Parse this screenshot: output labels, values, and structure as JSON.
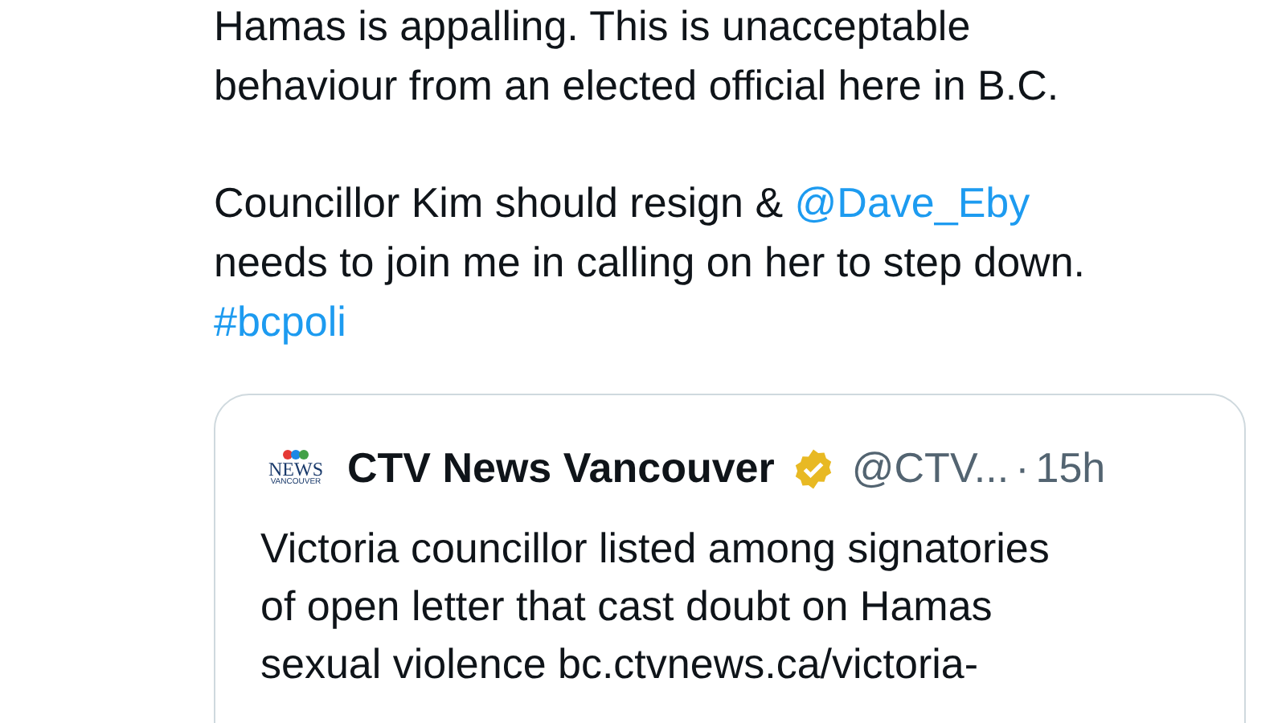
{
  "tweet": {
    "paragraphs": [
      [
        [
          {
            "kind": "text",
            "text": "Hamas is appalling. This is unacceptable"
          }
        ],
        [
          {
            "kind": "text",
            "text": "behaviour from an elected official here in B.C."
          }
        ]
      ],
      [
        [
          {
            "kind": "text",
            "text": "Councillor Kim should resign & "
          },
          {
            "kind": "link",
            "text": "@Dave_Eby"
          }
        ],
        [
          {
            "kind": "text",
            "text": "needs to join me in calling on her to step down."
          }
        ],
        [
          {
            "kind": "link",
            "text": "#bcpoli"
          }
        ]
      ]
    ]
  },
  "quoted_tweet": {
    "logo_text": [
      "NEWS",
      "VANCOUVER"
    ],
    "author": "CTV News Vancouver",
    "verified": true,
    "handle": "@CTV...",
    "separator": "·",
    "time": "15h",
    "lines": [
      "Victoria councillor listed among signatories",
      "of open letter that cast doubt on Hamas",
      "sexual violence bc.ctvnews.ca/victoria-"
    ]
  }
}
